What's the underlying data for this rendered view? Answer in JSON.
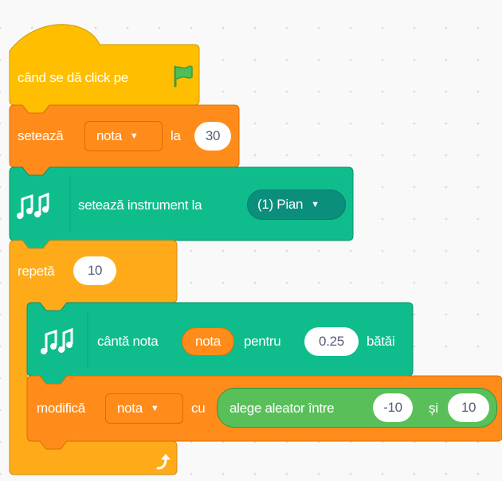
{
  "blocks": {
    "hat_label": "când se dă click pe",
    "set_var": {
      "label": "setează",
      "var": "nota",
      "to_label": "la",
      "value": "30"
    },
    "set_instrument": {
      "label": "setează instrument la",
      "instrument": "(1) Pian"
    },
    "repeat": {
      "label": "repetă",
      "times": "10"
    },
    "play_note": {
      "label": "cântă nota",
      "note": "nota",
      "for_label": "pentru",
      "beats": "0.25",
      "beats_label": "bătăi"
    },
    "change_var": {
      "label": "modifică",
      "var": "nota",
      "by_label": "cu",
      "random_label": "alege aleator între",
      "from": "-10",
      "and_label": "și",
      "to": "10"
    }
  },
  "icons": {
    "flag": "green-flag-icon",
    "music": "music-notes-icon",
    "dropdown": "caret-down-icon",
    "loop": "loop-arrow-icon"
  },
  "colors": {
    "events": "#ffbf00",
    "variables": "#ff8c1a",
    "music": "#0fbd8c",
    "control": "#ffab19",
    "operators": "#59c059"
  }
}
